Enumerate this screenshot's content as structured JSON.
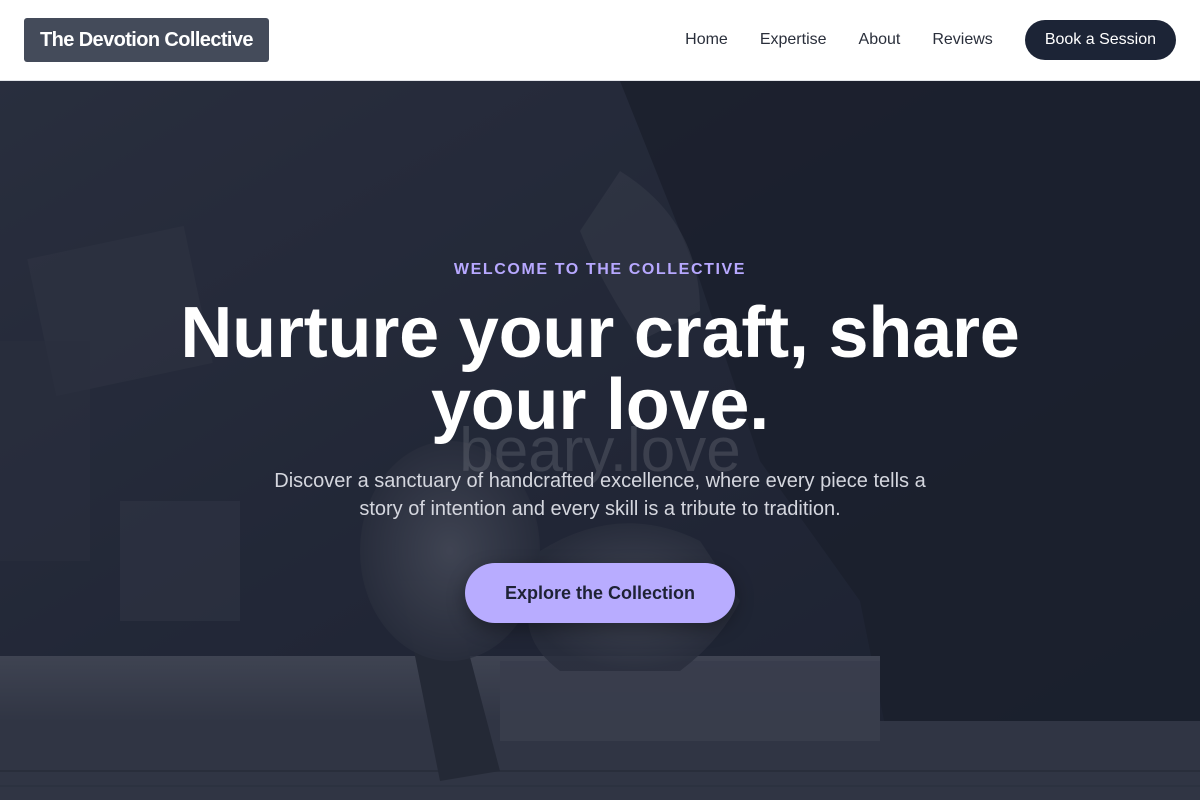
{
  "header": {
    "logo": "The Devotion Collective",
    "nav": [
      {
        "label": "Home"
      },
      {
        "label": "Expertise"
      },
      {
        "label": "About"
      },
      {
        "label": "Reviews"
      }
    ],
    "cta_label": "Book a Session"
  },
  "hero": {
    "eyebrow": "WELCOME TO THE COLLECTIVE",
    "headline": "Nurture your craft, share your love.",
    "subtext": "Discover a sanctuary of handcrafted excellence, where every piece tells a story of intention and every skill is a tribute to tradition.",
    "button_label": "Explore the Collection",
    "watermark": "beary.love",
    "background": "woodworking-hands-photo"
  },
  "colors": {
    "accent": "#b8acff",
    "dark": "#1c2436",
    "logo_bg": "#444b5a"
  }
}
